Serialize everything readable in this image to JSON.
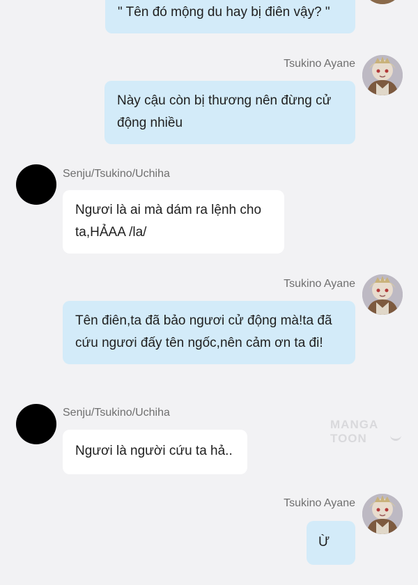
{
  "messages": [
    {
      "side": "right",
      "sender": "",
      "text": "\" Tên đó mộng du hay bị điên vậy? \""
    },
    {
      "side": "right",
      "sender": "Tsukino Ayane",
      "text": "Này cậu còn bị thương nên đừng cử\nđộng nhiều"
    },
    {
      "side": "left",
      "sender": "Senju/Tsukino/Uchiha",
      "text": "Ngươi là ai mà dám ra lệnh cho\nta,HẢAA /la/"
    },
    {
      "side": "right",
      "sender": "Tsukino Ayane",
      "text": "Tên điên,ta đã bảo ngươi cử động mà!ta đã\ncứu ngươi đấy tên ngốc,nên cảm ơn ta đi!"
    },
    {
      "side": "left",
      "sender": "Senju/Tsukino/Uchiha",
      "text": "Ngươi là người cứu ta hả.."
    },
    {
      "side": "right",
      "sender": "Tsukino Ayane",
      "text": "Ừ"
    }
  ],
  "watermark": "MANGA TOON",
  "colors": {
    "right_bubble": "#d3ebf9",
    "left_bubble": "#ffffff",
    "background": "#f2f2f4",
    "sender_name": "#6f6f6f"
  },
  "icons": {
    "right_avatar": "anime-girl-avatar",
    "left_avatar": "black-circle-avatar"
  }
}
